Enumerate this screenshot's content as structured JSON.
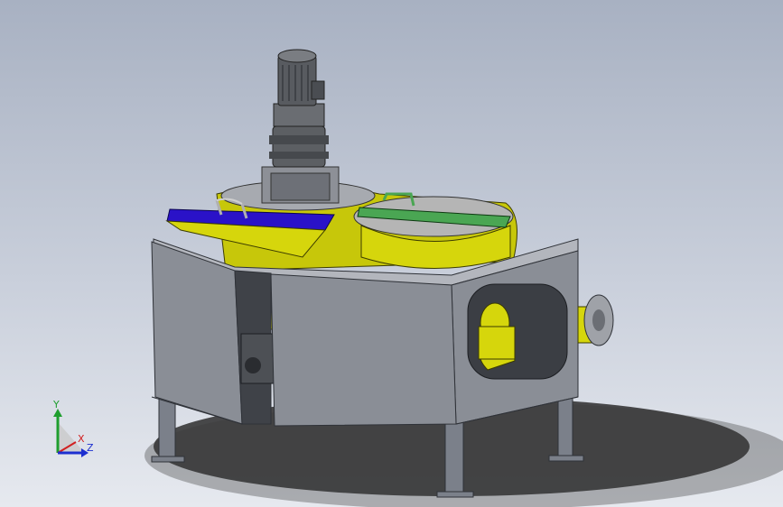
{
  "viewport": {
    "description_hidden": "",
    "colors": {
      "background_top": "#a8b1c2",
      "background_bottom": "#e6e9ef",
      "frame": "#7b808a",
      "frame_dark": "#4b4f57",
      "hopper": "#d6d60c",
      "hopper_shade": "#a9a800",
      "blue_lid": "#2a12c8",
      "green_lid": "#4aa653",
      "motor": "#5c5f63",
      "shadow": "#2d2d2d"
    },
    "icons": [
      "motor-icon",
      "gearbox-icon",
      "flange-icon"
    ]
  },
  "triad": {
    "y_label": "Y",
    "x_label": "X",
    "z_label": "Z",
    "colors": {
      "y": "#1e9e2e",
      "x": "#d12020",
      "z": "#1d2fd0"
    }
  }
}
